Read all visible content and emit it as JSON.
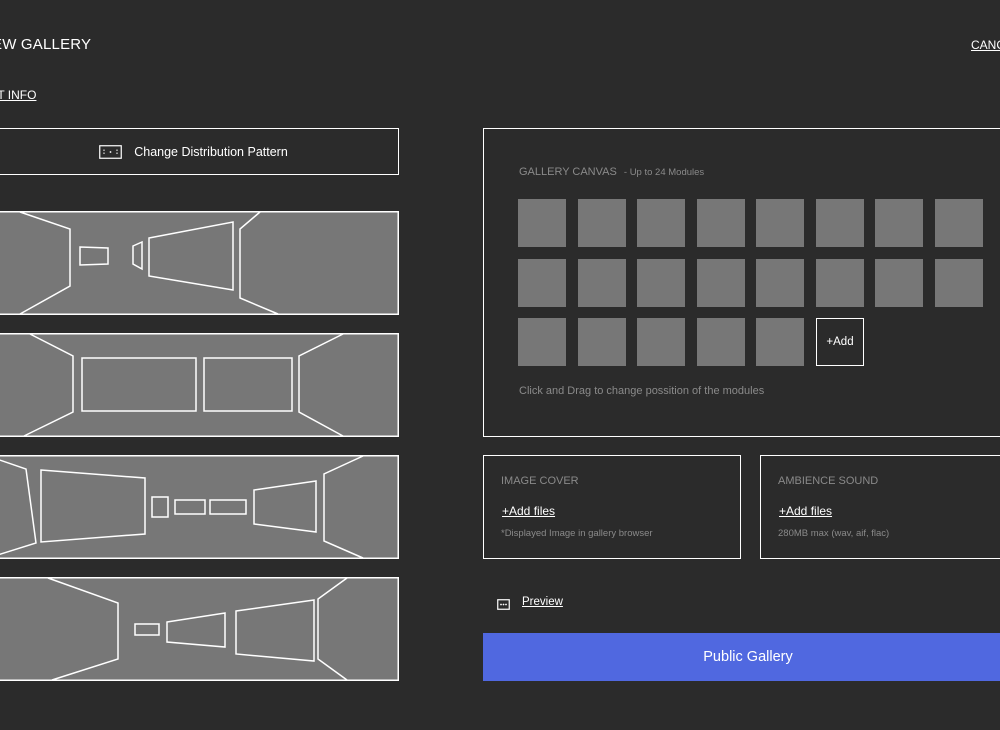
{
  "header": {
    "title": "EW GALLERY",
    "cancel_label": "CANC",
    "edit_info_label": "IT INFO"
  },
  "left_panel": {
    "change_pattern_label": "Change Distribution Pattern",
    "pattern_options_count": 4
  },
  "canvas": {
    "title": "GALLERY CANVAS",
    "subtitle": "-  Up to 24 Modules",
    "module_count": 21,
    "add_label": "+Add",
    "hint": "Click and Drag to change possition of the modules"
  },
  "image_cover": {
    "title": "IMAGE COVER",
    "add_label": "+Add files",
    "note": "*Displayed Image in gallery browser"
  },
  "ambience_sound": {
    "title": "AMBIENCE SOUND",
    "add_label": "+Add files",
    "note": "280MB max (wav, aif, flac)"
  },
  "preview": {
    "label": "Preview"
  },
  "publish": {
    "label": "Public Gallery"
  },
  "colors": {
    "background": "#2b2b2b",
    "module": "#777777",
    "muted_text": "#8a8a8a",
    "accent": "#5068e0",
    "outline": "#ffffff"
  },
  "icons": {
    "change_pattern": "dotted-frame-icon",
    "preview": "preview-icon"
  }
}
